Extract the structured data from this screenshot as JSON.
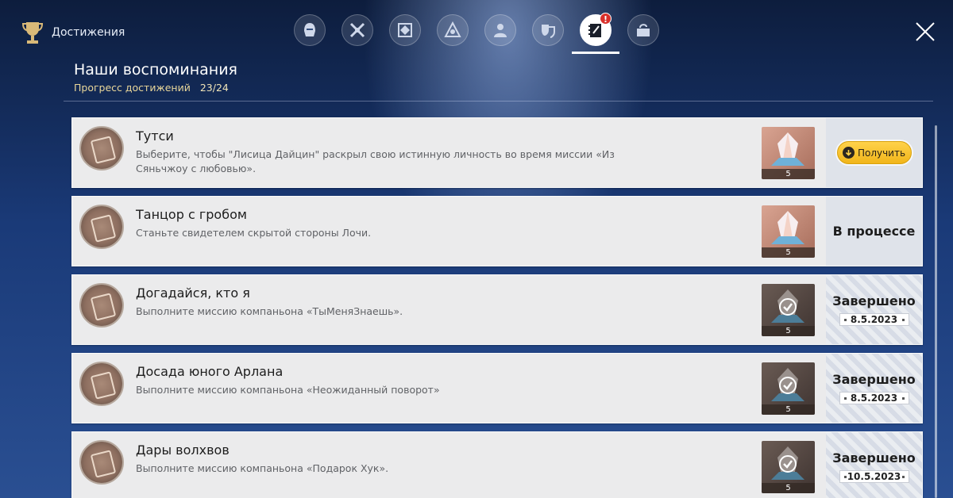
{
  "header": {
    "title": "Достижения",
    "trophy_icon": "trophy-icon",
    "close_icon": "close-icon"
  },
  "tabs": [
    {
      "icon": "knight-helmet-icon",
      "active": false
    },
    {
      "icon": "crossed-swords-icon",
      "active": false
    },
    {
      "icon": "crest-icon",
      "active": false
    },
    {
      "icon": "triangle-emblem-icon",
      "active": false
    },
    {
      "icon": "character-icon",
      "active": false
    },
    {
      "icon": "masks-icon",
      "active": false
    },
    {
      "icon": "notebook-icon",
      "active": true,
      "badge": "!"
    },
    {
      "icon": "puzzle-icon",
      "active": false
    }
  ],
  "section": {
    "title": "Наши воспоминания",
    "progress_label": "Прогресс достижений",
    "progress_value": "23/24"
  },
  "achievements": [
    {
      "title": "Тутси",
      "description": "Выберите, чтобы \"Лисица Дайцин\" раскрыл свою истинную личность во время миссии «Из Сяньчжоу с любовью».",
      "reward_qty": "5",
      "state": "claim",
      "claim_label": "Получить"
    },
    {
      "title": "Танцор с гробом",
      "description": "Станьте свидетелем скрытой стороны Лочи.",
      "reward_qty": "5",
      "state": "in_progress",
      "status": "В процессе"
    },
    {
      "title": "Догадайся, кто я",
      "description": "Выполните миссию компаньона «ТыМеняЗнаешь».",
      "reward_qty": "5",
      "state": "done",
      "status": "Завершено",
      "date": "8.5.2023"
    },
    {
      "title": "Досада юного Арлана",
      "description": "Выполните миссию компаньона «Неожиданный поворот»",
      "reward_qty": "5",
      "state": "done",
      "status": "Завершено",
      "date": "8.5.2023"
    },
    {
      "title": "Дары волхвов",
      "description": "Выполните миссию компаньона «Подарок Хук».",
      "reward_qty": "5",
      "state": "done",
      "status": "Завершено",
      "date": "10.5.2023"
    }
  ],
  "colors": {
    "claim_button": "#f1b51b",
    "progress_text": "#e9d79a",
    "card_bg": "#ebebec",
    "alert": "#d9302a"
  }
}
